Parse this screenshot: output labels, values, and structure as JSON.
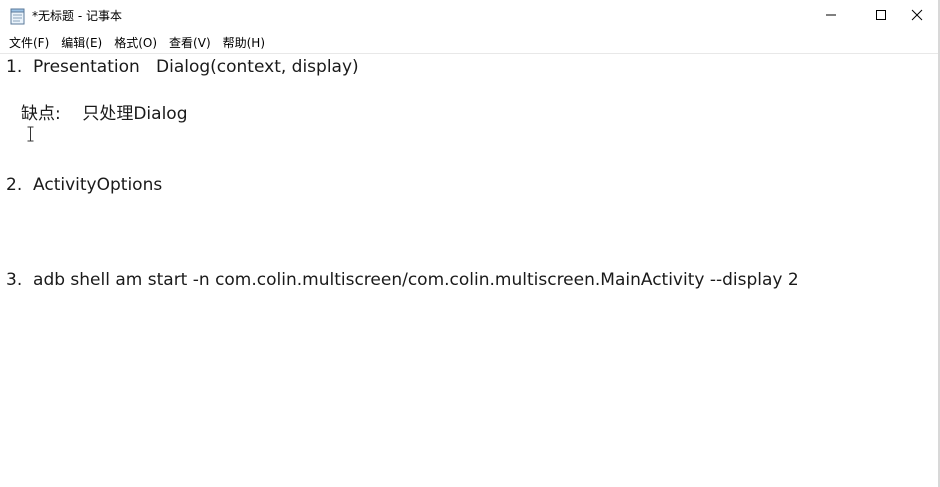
{
  "window": {
    "title": "*无标题 - 记事本",
    "app_icon": "notepad-icon"
  },
  "controls": {
    "minimize_icon": "minimize-icon",
    "maximize_icon": "maximize-icon",
    "close_icon": "close-icon"
  },
  "menu": {
    "items": [
      {
        "label": "文件(F)"
      },
      {
        "label": "编辑(E)"
      },
      {
        "label": "格式(O)"
      },
      {
        "label": "查看(V)"
      },
      {
        "label": "帮助(H)"
      }
    ]
  },
  "editor": {
    "lines": [
      "1.  Presentation   Dialog(context, display)",
      "缺点:    只处理Dialog",
      "2.  ActivityOptions",
      "3.  adb shell am start -n com.colin.multiscreen/com.colin.multiscreen.MainActivity --display 2"
    ],
    "cursor_icon": "text-ibeam-icon"
  }
}
